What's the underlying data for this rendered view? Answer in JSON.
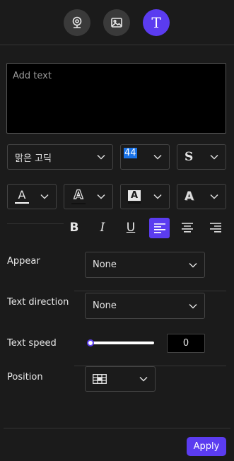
{
  "top_tabs": [
    {
      "icon": "webcam-icon",
      "active": false
    },
    {
      "icon": "image-icon",
      "active": false
    },
    {
      "icon": "text-tool-icon",
      "active": true,
      "glyph": "T"
    }
  ],
  "text_input": {
    "placeholder": "Add text",
    "value": ""
  },
  "font": {
    "family": "맑은 고딕",
    "size": "44",
    "style": "S"
  },
  "color_buttons": [
    {
      "icon": "font-color-icon",
      "glyph": "A"
    },
    {
      "icon": "text-outline-icon",
      "glyph": "A"
    },
    {
      "icon": "text-background-icon",
      "glyph": "A"
    },
    {
      "icon": "text-shadow-icon",
      "glyph": "A"
    }
  ],
  "format": {
    "bold": "B",
    "italic": "I",
    "underline": "U",
    "align_selected": "left"
  },
  "appear": {
    "label": "Appear",
    "value": "None"
  },
  "text_direction": {
    "label": "Text direction",
    "value": "None"
  },
  "text_speed": {
    "label": "Text speed",
    "value": "0",
    "slider_level": 0
  },
  "position": {
    "label": "Position"
  },
  "apply_label": "Apply",
  "colors": {
    "accent": "#5b3cf0",
    "background": "#1b1b1b",
    "highlight": "#1a73e8"
  }
}
